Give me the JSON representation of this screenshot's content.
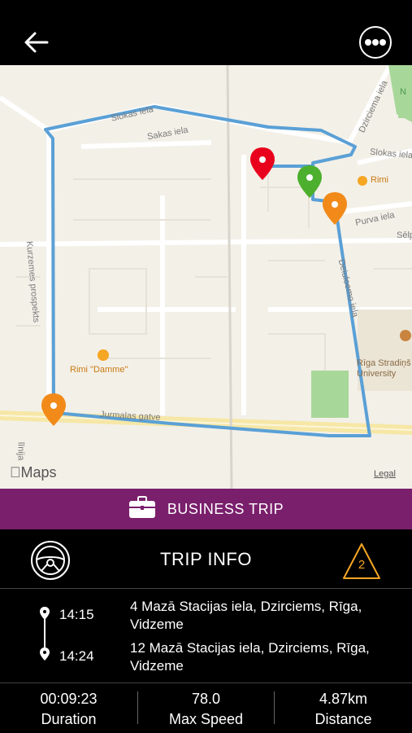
{
  "map": {
    "streets": {
      "slokas_iela_top": "Slokas iela",
      "sakas_iela": "Sakas iela",
      "dzirciema_iela": "Dzirciema iela",
      "slokas_iela_right": "Slokas iela",
      "rimi_right": "Rimi",
      "purva_iela": "Purva iela",
      "selp": "Sēlp",
      "kurzemes_prospekts": "Kurzemes prospekts",
      "rimi_damme": "Rimi \"Damme\"",
      "riga_stradins": "Rīga Stradiņš University",
      "jurmalas_gatve": "Jurmalas gatve",
      "linija": "līnija",
      "n_label": "N",
      "dzelzceļa": "Deiuloemo iela"
    },
    "attribution": "Maps",
    "legal": "Legal",
    "route_color": "#5aa0d6",
    "pin_colors": {
      "start": "#e8001c",
      "end": "#4caf2e",
      "warning": "#f28a1a"
    }
  },
  "trip_type": {
    "label": "BUSINESS TRIP",
    "color": "#7a1f6c"
  },
  "trip_info": {
    "title": "TRIP INFO",
    "warning_count": "2",
    "warning_color": "#f5a623"
  },
  "route": {
    "start": {
      "time": "14:15",
      "address": "4 Mazā Stacijas iela, Dzirciems, Rīga, Vidzeme"
    },
    "end": {
      "time": "14:24",
      "address": "12 Mazā Stacijas iela, Dzirciems, Rīga, Vidzeme"
    }
  },
  "stats": [
    {
      "value": "00:09:23",
      "label": "Duration"
    },
    {
      "value": "78.0",
      "label": "Max Speed"
    },
    {
      "value": "4.87km",
      "label": "Distance"
    }
  ]
}
